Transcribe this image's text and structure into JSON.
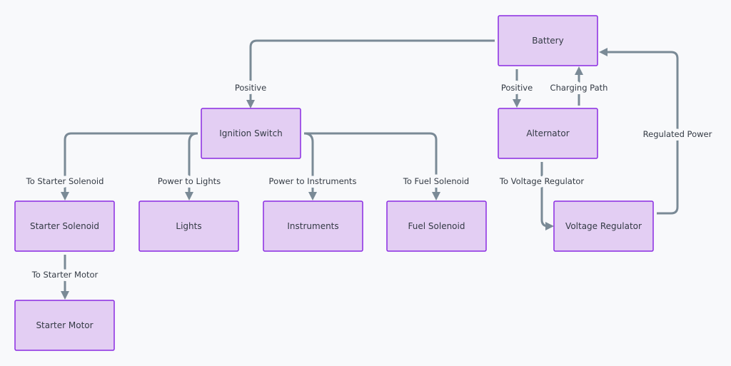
{
  "colors": {
    "background": "#f8f9fb",
    "node_fill": "#e3cef3",
    "node_border": "#8a2be2",
    "edge": "#7a8a96",
    "text": "#333a44"
  },
  "nodes": {
    "battery": "Battery",
    "ignition_switch": "Ignition Switch",
    "alternator": "Alternator",
    "starter_solenoid": "Starter Solenoid",
    "lights": "Lights",
    "instruments": "Instruments",
    "fuel_solenoid": "Fuel Solenoid",
    "voltage_regulator": "Voltage Regulator",
    "starter_motor": "Starter Motor"
  },
  "edges": {
    "battery_ignition": "Positive",
    "battery_alternator": "Positive",
    "alternator_battery": "Charging Path",
    "ignition_starter_solenoid": "To Starter Solenoid",
    "ignition_lights": "Power to Lights",
    "ignition_instruments": "Power to Instruments",
    "ignition_fuel_solenoid": "To Fuel Solenoid",
    "alternator_voltage_regulator": "To Voltage Regulator",
    "voltage_regulator_battery": "Regulated Power",
    "starter_solenoid_motor": "To Starter Motor"
  }
}
